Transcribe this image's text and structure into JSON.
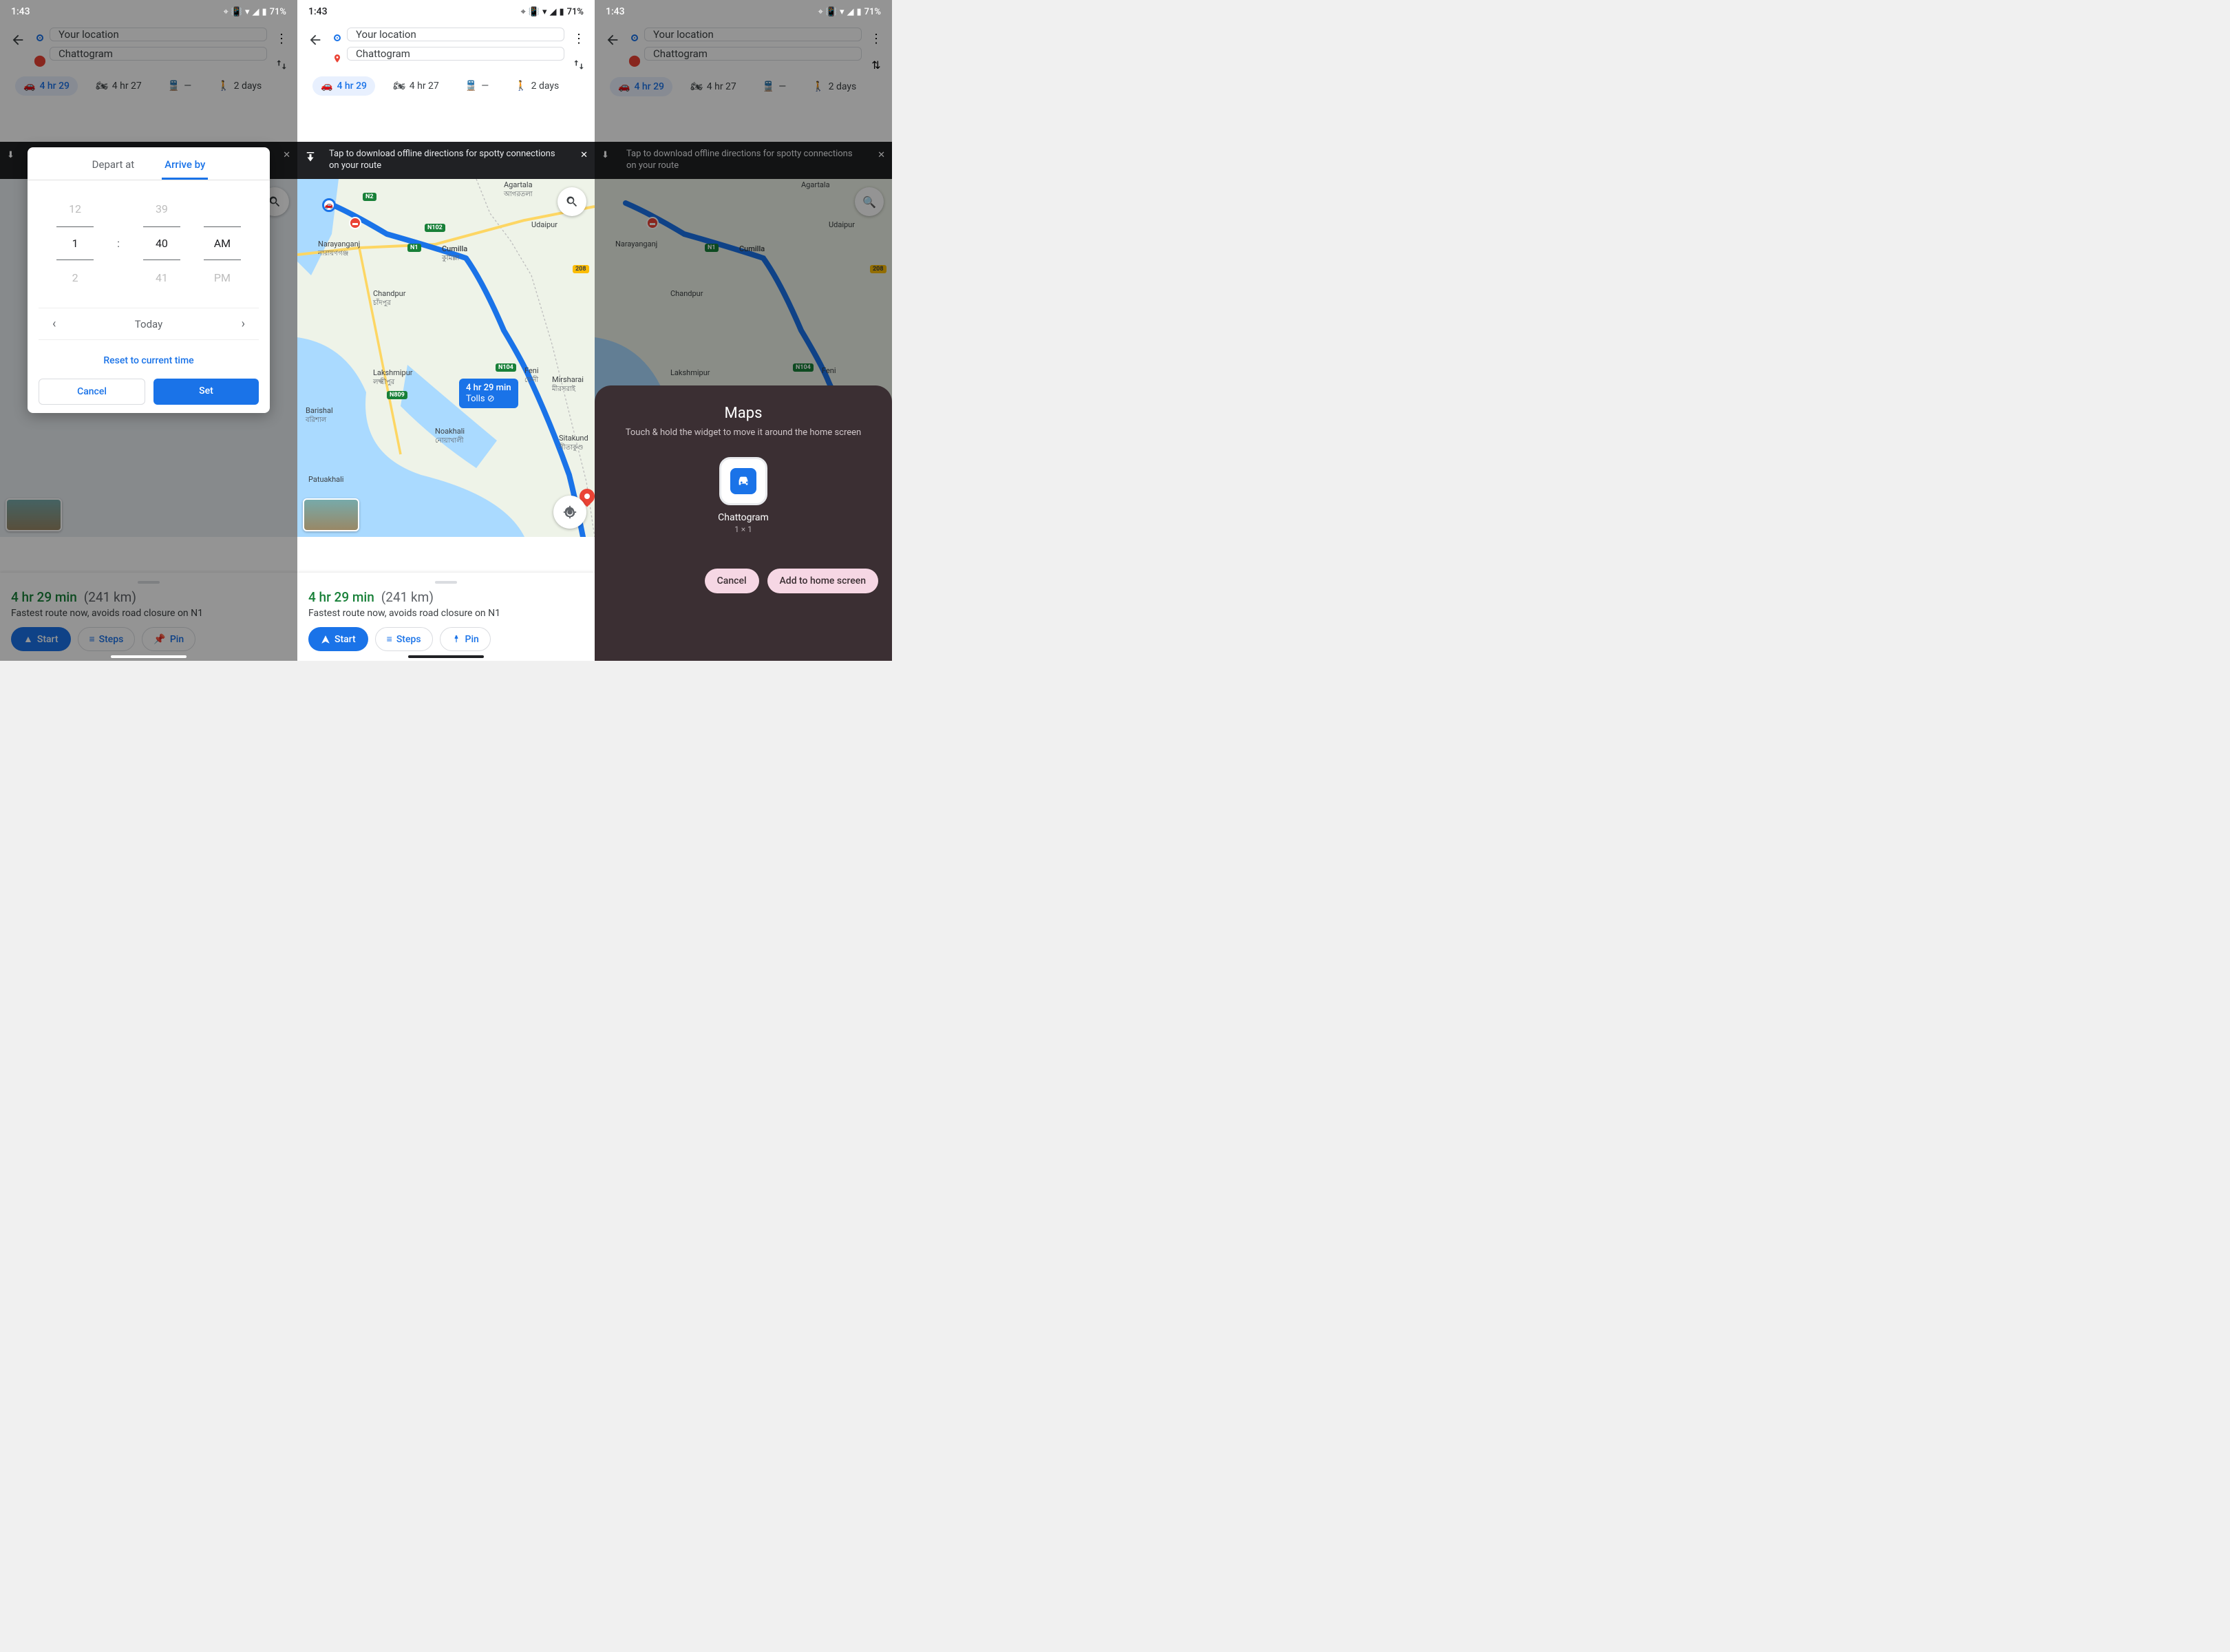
{
  "statusbar": {
    "time": "1:43",
    "battery": "71%"
  },
  "route": {
    "from": "Your location",
    "to": "Chattogram"
  },
  "modes": {
    "drive": "4 hr 29",
    "motorcycle": "4 hr 27",
    "transit": "—",
    "walk": "2 days"
  },
  "banner": {
    "text": "Tap to download offline directions for spotty connections on your route"
  },
  "mapRouteLabel": {
    "line1": "4 hr 29 min",
    "line2": "Tolls ⊘"
  },
  "mapPlaces": {
    "agartala": "Agartala",
    "agartala_sub": "আগরতলা",
    "narayanganj": "Narayanganj",
    "narayanganj_sub": "নারায়ণগঞ্জ",
    "cumilla": "Cumilla",
    "cumilla_sub": "কুমিল্লা",
    "udaipur": "Udaipur",
    "chandpur": "Chandpur",
    "chandpur_sub": "চাঁদপুর",
    "lakshmipur": "Lakshmipur",
    "lakshmipur_sub": "লক্ষ্মীপুর",
    "feni": "Feni",
    "feni_sub": "ফেনী",
    "mirsharai": "Mirsharai",
    "mirsharai_sub": "মীরসরাই",
    "sitakund": "Sitakund",
    "sitakund_sub": "সীতাকুণ্ড",
    "barishal": "Barishal",
    "barishal_sub": "বরিশাল",
    "patuakhali": "Patuakhali",
    "noakhali": "Noakhali",
    "noakhali_sub": "নোয়াখালী"
  },
  "roads": {
    "n1": "N1",
    "n2": "N2",
    "n102": "N102",
    "n104": "N104",
    "n809": "N809",
    "r208": "208"
  },
  "sheet": {
    "time": "4 hr 29 min",
    "dist": "(241 km)",
    "desc": "Fastest route now, avoids road closure on N1",
    "start": "Start",
    "steps": "Steps",
    "pin": "Pin"
  },
  "dialog": {
    "depart": "Depart at",
    "arrive": "Arrive by",
    "hour_prev": "12",
    "hour_sel": "1",
    "hour_next": "2",
    "min_prev": "39",
    "min_sel": "40",
    "min_next": "41",
    "mer_sel": "AM",
    "mer_next": "PM",
    "date": "Today",
    "reset": "Reset to current time",
    "cancel": "Cancel",
    "set": "Set"
  },
  "widget": {
    "title": "Maps",
    "hint": "Touch & hold the widget to move it around the home screen",
    "name": "Chattogram",
    "size": "1 × 1",
    "cancel": "Cancel",
    "add": "Add to home screen"
  }
}
